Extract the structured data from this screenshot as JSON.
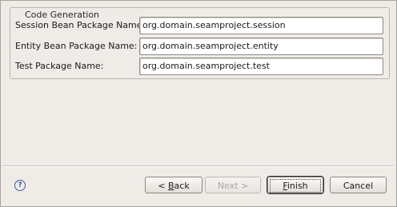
{
  "group": {
    "title": "Code Generation"
  },
  "fields": [
    {
      "label": "Session Bean Package Name:",
      "value": "org.domain.seamproject.session"
    },
    {
      "label": "Entity Bean Package Name:",
      "value": "org.domain.seamproject.entity"
    },
    {
      "label": "Test Package Name:",
      "value": "org.domain.seamproject.test"
    }
  ],
  "help": {
    "icon": "help-icon",
    "glyph": "?"
  },
  "buttons": {
    "back": {
      "prefix": "< ",
      "mnemonic": "B",
      "rest": "ack",
      "enabled": true
    },
    "next": {
      "label": "Next >",
      "enabled": false
    },
    "finish": {
      "mnemonic": "F",
      "rest": "inish",
      "enabled": true,
      "default": true
    },
    "cancel": {
      "label": "Cancel",
      "enabled": true
    }
  }
}
